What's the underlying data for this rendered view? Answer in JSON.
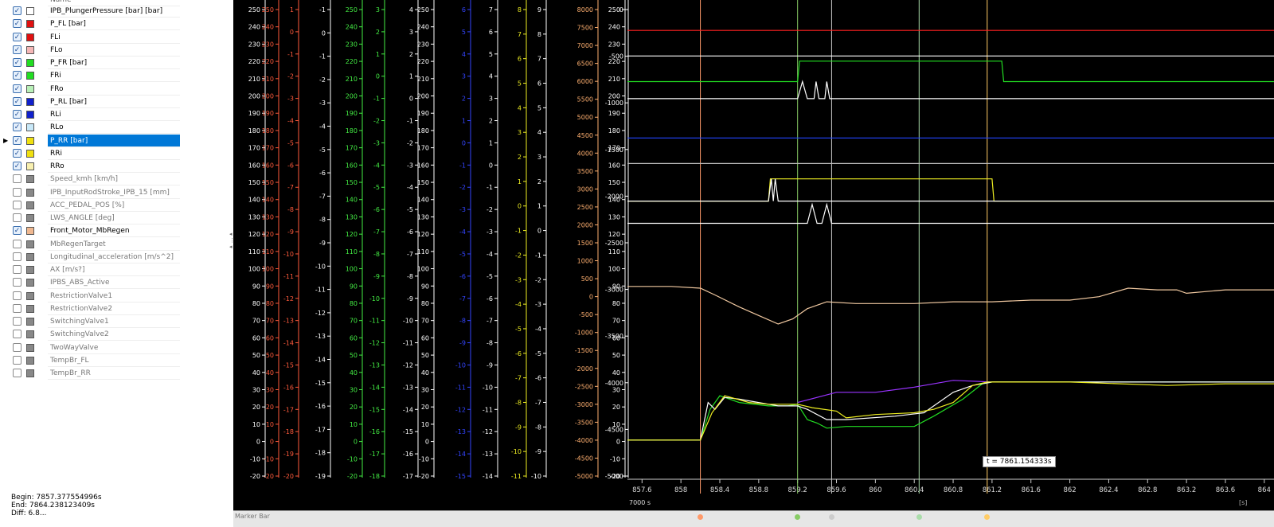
{
  "signals": [
    {
      "label": "IPB_PlungerPressure [bar] [bar]",
      "checked": true,
      "color": "#ffffff"
    },
    {
      "label": "P_FL [bar]",
      "checked": true,
      "color": "#e01010"
    },
    {
      "label": "FLi",
      "checked": true,
      "color": "#e01010"
    },
    {
      "label": "FLo",
      "checked": true,
      "color": "#f5b7b7"
    },
    {
      "label": "P_FR [bar]",
      "checked": true,
      "color": "#22dd22"
    },
    {
      "label": "FRi",
      "checked": true,
      "color": "#22dd22"
    },
    {
      "label": "FRo",
      "checked": true,
      "color": "#b8f0b8"
    },
    {
      "label": "P_RL [bar]",
      "checked": true,
      "color": "#1020cc"
    },
    {
      "label": "RLi",
      "checked": true,
      "color": "#1020cc"
    },
    {
      "label": "RLo",
      "checked": true,
      "color": "#c8e8f8"
    },
    {
      "label": "P_RR [bar]",
      "checked": true,
      "color": "#f0e010",
      "selected": true
    },
    {
      "label": "RRi",
      "checked": true,
      "color": "#f0e010"
    },
    {
      "label": "RRo",
      "checked": true,
      "color": "#f8f0b0"
    },
    {
      "label": "Speed_kmh [km/h]",
      "checked": false,
      "color": "#888888"
    },
    {
      "label": "IPB_InputRodStroke_IPB_15 [mm]",
      "checked": false,
      "color": "#888888"
    },
    {
      "label": "ACC_PEDAL_POS [%]",
      "checked": false,
      "color": "#888888"
    },
    {
      "label": "LWS_ANGLE [deg]",
      "checked": false,
      "color": "#888888"
    },
    {
      "label": "Front_Motor_MbRegen",
      "checked": true,
      "color": "#f0b890"
    },
    {
      "label": "MbRegenTarget",
      "checked": false,
      "color": "#888888"
    },
    {
      "label": "Longitudinal_acceleration [m/s^2]",
      "checked": false,
      "color": "#888888"
    },
    {
      "label": "AX [m/s?]",
      "checked": false,
      "color": "#888888"
    },
    {
      "label": "IPBS_ABS_Active",
      "checked": false,
      "color": "#888888"
    },
    {
      "label": "RestrictionValve1",
      "checked": false,
      "color": "#888888"
    },
    {
      "label": "RestrictionValve2",
      "checked": false,
      "color": "#888888"
    },
    {
      "label": "SwitchingValve1",
      "checked": false,
      "color": "#888888"
    },
    {
      "label": "SwitchingValve2",
      "checked": false,
      "color": "#888888"
    },
    {
      "label": "TwoWayValve",
      "checked": false,
      "color": "#888888"
    },
    {
      "label": "TempBr_FL",
      "checked": false,
      "color": "#888888"
    },
    {
      "label": "TempBr_RR",
      "checked": false,
      "color": "#888888"
    }
  ],
  "header_label": "Name",
  "range": {
    "begin": "Begin: 7857.377554996s",
    "end": "End: 7864.238123409s",
    "diff": "Diff: 6.8..."
  },
  "marker_bar_label": "Marker Bar",
  "cursor_label": "t = 7861.154333s",
  "time_axis": {
    "origin_label": "7000 s",
    "unit_label": "[s]",
    "ticks": [
      "857.6",
      "858",
      "858.4",
      "858.8",
      "859.2",
      "859.6",
      "860",
      "860.4",
      "860.8",
      "861.2",
      "861.6",
      "862",
      "862.4",
      "862.8",
      "863.2",
      "863.6",
      "864"
    ]
  },
  "chart_data": {
    "type": "line",
    "x_range": [
      857.45,
      864.1
    ],
    "axes": [
      {
        "color": "#ffffff",
        "ticks": [
          "250",
          "240",
          "230",
          "220",
          "210",
          "200",
          "190",
          "180",
          "170",
          "160",
          "150",
          "140",
          "130",
          "120",
          "110",
          "100",
          "90",
          "80",
          "70",
          "60",
          "50",
          "40",
          "30",
          "20",
          "10",
          "0",
          "-10",
          "-20"
        ]
      },
      {
        "color": "#ff5a3c",
        "ticks": [
          "250",
          "240",
          "230",
          "220",
          "210",
          "200",
          "190",
          "180",
          "170",
          "160",
          "150",
          "140",
          "130",
          "120",
          "110",
          "100",
          "90",
          "80",
          "70",
          "60",
          "50",
          "40",
          "30",
          "20",
          "10",
          "0",
          "-10",
          "-20"
        ]
      },
      {
        "color": "#ff5a3c",
        "ticks": [
          "1",
          "0",
          "-1",
          "-2",
          "-3",
          "-4",
          "-5",
          "-6",
          "-7",
          "-8",
          "-9",
          "-10",
          "-11",
          "-12",
          "-13",
          "-14",
          "-15",
          "-16",
          "-17",
          "-18",
          "-19",
          "-20"
        ]
      },
      {
        "color": "#ffffff",
        "ticks": [
          "-1",
          "0",
          "-1",
          "-2",
          "-3",
          "-4",
          "-5",
          "-6",
          "-7",
          "-8",
          "-9",
          "-10",
          "-11",
          "-12",
          "-13",
          "-14",
          "-15",
          "-16",
          "-17",
          "-18",
          "-19"
        ]
      },
      {
        "color": "#44ee44",
        "ticks": [
          "250",
          "240",
          "230",
          "220",
          "210",
          "200",
          "190",
          "180",
          "170",
          "160",
          "150",
          "140",
          "130",
          "120",
          "110",
          "100",
          "90",
          "80",
          "70",
          "60",
          "50",
          "40",
          "30",
          "20",
          "10",
          "0",
          "-10",
          "-20"
        ]
      },
      {
        "color": "#44ee44",
        "ticks": [
          "3",
          "2",
          "1",
          "0",
          "-1",
          "-2",
          "-3",
          "-4",
          "-5",
          "-6",
          "-7",
          "-8",
          "-9",
          "-10",
          "-11",
          "-12",
          "-13",
          "-14",
          "-15",
          "-16",
          "-17",
          "-18"
        ]
      },
      {
        "color": "#ffffff",
        "ticks": [
          "4",
          "3",
          "2",
          "1",
          "0",
          "-1",
          "-2",
          "-3",
          "-4",
          "-5",
          "-6",
          "-7",
          "-8",
          "-9",
          "-10",
          "-11",
          "-12",
          "-13",
          "-14",
          "-15",
          "-16",
          "-17"
        ]
      },
      {
        "color": "#ffffff",
        "ticks": [
          "250",
          "240",
          "230",
          "220",
          "210",
          "200",
          "190",
          "180",
          "170",
          "160",
          "150",
          "140",
          "130",
          "120",
          "110",
          "100",
          "90",
          "80",
          "70",
          "60",
          "50",
          "40",
          "30",
          "20",
          "10",
          "0",
          "-10",
          "-20"
        ]
      },
      {
        "color": "#3344ff",
        "ticks": [
          "6",
          "5",
          "4",
          "3",
          "2",
          "1",
          "0",
          "-1",
          "-2",
          "-3",
          "-4",
          "-5",
          "-6",
          "-7",
          "-8",
          "-9",
          "-10",
          "-11",
          "-12",
          "-13",
          "-14",
          "-15"
        ]
      },
      {
        "color": "#ffffff",
        "ticks": [
          "7",
          "6",
          "5",
          "4",
          "3",
          "2",
          "1",
          "0",
          "-1",
          "-2",
          "-3",
          "-4",
          "-5",
          "-6",
          "-7",
          "-8",
          "-9",
          "-10",
          "-11",
          "-12",
          "-13",
          "-14"
        ]
      },
      {
        "color": "#eeee22",
        "ticks": [
          "8",
          "7",
          "6",
          "5",
          "4",
          "3",
          "2",
          "1",
          "0",
          "-1",
          "-2",
          "-3",
          "-4",
          "-5",
          "-6",
          "-7",
          "-8",
          "-9",
          "-10",
          "-11"
        ]
      },
      {
        "color": "#ffffff",
        "ticks": [
          "9",
          "8",
          "7",
          "6",
          "5",
          "4",
          "3",
          "2",
          "1",
          "0",
          "-1",
          "-2",
          "-3",
          "-4",
          "-5",
          "-6",
          "-7",
          "-8",
          "-9",
          "-10"
        ]
      },
      {
        "color": "#ffb070",
        "ticks": [
          "8000",
          "7500",
          "7000",
          "6500",
          "6000",
          "5500",
          "5000",
          "4500",
          "4000",
          "3500",
          "3000",
          "2500",
          "2000",
          "1500",
          "1000",
          "500",
          "0",
          "-500",
          "-1000",
          "-1500",
          "-2000",
          "-2500",
          "-3000",
          "-3500",
          "-4000",
          "-4500",
          "-5000"
        ]
      },
      {
        "color": "#ffffff",
        "ticks": [
          "250",
          "240",
          "230",
          "220",
          "210",
          "200",
          "190",
          "180",
          "170",
          "160",
          "150",
          "140",
          "130",
          "120",
          "110",
          "100",
          "90",
          "80",
          "70",
          "60",
          "50",
          "40",
          "30",
          "20",
          "10",
          "0",
          "-10",
          "-20"
        ]
      },
      {
        "color": "#ffffff",
        "ticks": [
          "0",
          "-500",
          "-1000",
          "-1500",
          "-2000",
          "-2500",
          "-3000",
          "-3500",
          "-4000",
          "-4500",
          "-5000"
        ]
      }
    ],
    "markers": [
      {
        "x": 858.2,
        "color": "#ff9a6a"
      },
      {
        "x": 859.2,
        "color": "#88cc66"
      },
      {
        "x": 859.55,
        "color": "#cccccc"
      },
      {
        "x": 860.45,
        "color": "#aaddaa"
      },
      {
        "x": 861.15,
        "color": "#ffcc66"
      }
    ],
    "series": [
      {
        "color": "#ff2020",
        "points": [
          [
            857.45,
            240
          ],
          [
            864.1,
            240
          ]
        ]
      },
      {
        "color": "#ffffff",
        "points": [
          [
            857.45,
            225
          ],
          [
            864.1,
            225
          ]
        ]
      },
      {
        "color": "#22dd22",
        "points": [
          [
            857.45,
            210
          ],
          [
            859.2,
            210
          ],
          [
            859.22,
            222
          ],
          [
            861.3,
            222
          ],
          [
            861.32,
            210
          ],
          [
            864.1,
            210
          ]
        ]
      },
      {
        "color": "#ffffff",
        "points": [
          [
            857.45,
            200
          ],
          [
            859.2,
            200
          ],
          [
            859.25,
            210
          ],
          [
            859.3,
            200
          ],
          [
            859.37,
            200
          ],
          [
            859.39,
            210
          ],
          [
            859.42,
            200
          ],
          [
            859.48,
            200
          ],
          [
            859.5,
            210
          ],
          [
            859.53,
            200
          ],
          [
            864.1,
            200
          ]
        ]
      },
      {
        "color": "#2244ff",
        "points": [
          [
            857.45,
            177
          ],
          [
            864.1,
            177
          ]
        ]
      },
      {
        "color": "#bbbbbb",
        "points": [
          [
            857.45,
            162
          ],
          [
            864.1,
            162
          ]
        ]
      },
      {
        "color": "#eeee22",
        "points": [
          [
            857.45,
            140
          ],
          [
            858.9,
            140
          ],
          [
            858.92,
            153
          ],
          [
            859.0,
            153
          ],
          [
            861.2,
            153
          ],
          [
            861.22,
            140
          ],
          [
            864.1,
            140
          ]
        ]
      },
      {
        "color": "#ffffff",
        "points": [
          [
            857.45,
            140
          ],
          [
            858.9,
            140
          ],
          [
            858.93,
            153
          ],
          [
            858.95,
            140
          ],
          [
            858.97,
            153
          ],
          [
            859.0,
            140
          ],
          [
            864.1,
            140
          ]
        ]
      },
      {
        "color": "#ffffff",
        "points": [
          [
            857.45,
            127
          ],
          [
            859.3,
            127
          ],
          [
            859.35,
            138
          ],
          [
            859.4,
            127
          ],
          [
            859.45,
            127
          ],
          [
            859.5,
            138
          ],
          [
            859.55,
            127
          ],
          [
            864.1,
            127
          ]
        ]
      },
      {
        "color": "#f0c8a0",
        "points": [
          [
            857.45,
            90
          ],
          [
            857.9,
            90
          ],
          [
            858.2,
            89
          ],
          [
            858.35,
            85
          ],
          [
            858.6,
            78
          ],
          [
            858.8,
            73
          ],
          [
            859.0,
            68
          ],
          [
            859.15,
            71
          ],
          [
            859.3,
            77
          ],
          [
            859.5,
            81
          ],
          [
            859.8,
            80
          ],
          [
            860.0,
            80
          ],
          [
            860.4,
            80
          ],
          [
            860.8,
            81
          ],
          [
            861.2,
            81
          ],
          [
            861.6,
            82
          ],
          [
            862.0,
            82
          ],
          [
            862.3,
            84
          ],
          [
            862.6,
            89
          ],
          [
            862.9,
            88
          ],
          [
            863.1,
            88
          ],
          [
            863.2,
            86
          ],
          [
            863.6,
            88
          ],
          [
            864.1,
            88
          ]
        ]
      },
      {
        "color": "#9933ff",
        "points": [
          [
            859.2,
            22
          ],
          [
            859.6,
            28
          ],
          [
            860.0,
            28
          ],
          [
            860.4,
            31
          ],
          [
            860.8,
            35
          ],
          [
            861.2,
            34
          ],
          [
            864.1,
            34
          ]
        ]
      },
      {
        "color": "#22dd22",
        "points": [
          [
            857.45,
            0
          ],
          [
            858.2,
            0
          ],
          [
            858.3,
            18
          ],
          [
            858.4,
            26
          ],
          [
            858.6,
            22
          ],
          [
            858.9,
            20
          ],
          [
            859.1,
            20
          ],
          [
            859.2,
            21
          ],
          [
            859.3,
            12
          ],
          [
            859.4,
            10
          ],
          [
            859.5,
            7
          ],
          [
            859.7,
            8
          ],
          [
            860.4,
            8
          ],
          [
            860.6,
            14
          ],
          [
            860.9,
            24
          ],
          [
            861.1,
            33
          ],
          [
            861.2,
            34
          ],
          [
            864.1,
            34
          ]
        ]
      },
      {
        "color": "#ffffff",
        "points": [
          [
            857.45,
            0
          ],
          [
            858.2,
            0
          ],
          [
            858.28,
            22
          ],
          [
            858.35,
            18
          ],
          [
            858.45,
            25
          ],
          [
            858.6,
            24
          ],
          [
            859.0,
            20
          ],
          [
            859.2,
            20
          ],
          [
            859.3,
            18
          ],
          [
            859.5,
            12
          ],
          [
            859.7,
            12
          ],
          [
            860.2,
            14
          ],
          [
            860.5,
            16
          ],
          [
            860.8,
            28
          ],
          [
            861.0,
            32
          ],
          [
            861.2,
            34
          ],
          [
            864.1,
            34
          ]
        ]
      },
      {
        "color": "#eeee22",
        "points": [
          [
            857.45,
            0
          ],
          [
            858.2,
            0
          ],
          [
            858.32,
            16
          ],
          [
            858.45,
            26
          ],
          [
            858.7,
            22
          ],
          [
            858.9,
            21
          ],
          [
            859.2,
            21
          ],
          [
            859.35,
            19
          ],
          [
            859.6,
            17
          ],
          [
            859.7,
            13
          ],
          [
            860.0,
            15
          ],
          [
            860.4,
            16
          ],
          [
            860.6,
            18
          ],
          [
            860.8,
            22
          ],
          [
            861.0,
            32
          ],
          [
            861.15,
            34
          ],
          [
            862.0,
            34
          ],
          [
            863.0,
            32
          ],
          [
            863.6,
            33
          ],
          [
            864.1,
            33
          ]
        ]
      }
    ]
  }
}
